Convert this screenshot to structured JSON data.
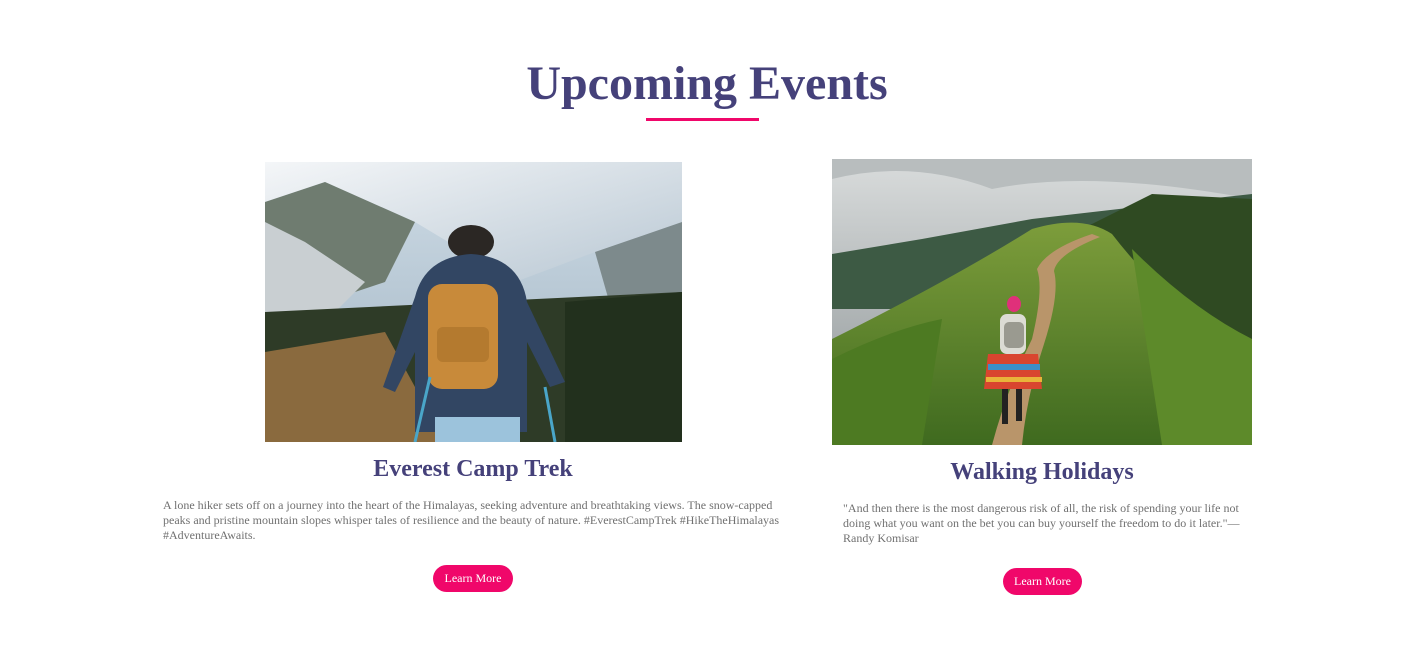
{
  "section": {
    "title": "Upcoming Events",
    "accent_color": "#f0076a",
    "title_color": "#45417a"
  },
  "events": [
    {
      "title": "Everest Camp Trek",
      "image_icon": "hiker-mountain-photo",
      "description": "A lone hiker sets off on a journey into the heart of the Himalayas, seeking adventure and breathtaking views. The snow-capped peaks and pristine mountain slopes whisper tales of resilience and the beauty of nature. #EverestCampTrek #HikeTheHimalayas #AdventureAwaits.",
      "button_label": "Learn More"
    },
    {
      "title": "Walking Holidays",
      "image_icon": "walker-green-ridge-photo",
      "description": "\"And then there is the most dangerous risk of all, the risk of spending your life not doing what you want on the bet you can buy yourself the freedom to do it later.\"— Randy Komisar",
      "button_label": "Learn More"
    }
  ]
}
